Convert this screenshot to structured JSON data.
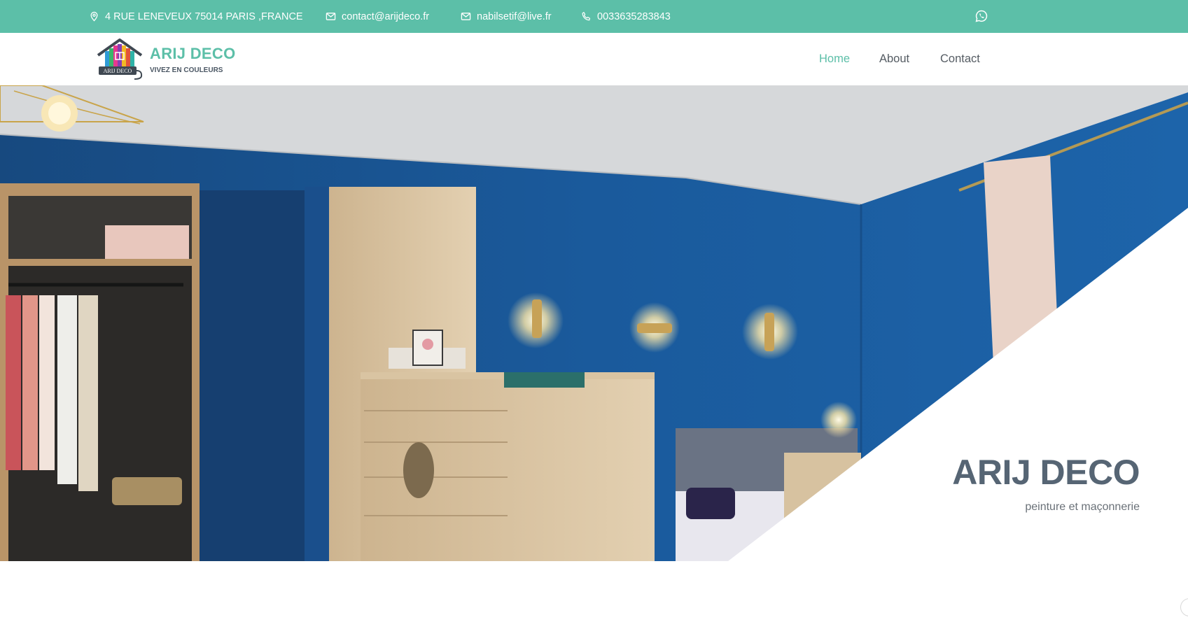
{
  "topbar": {
    "address": "4 RUE LENEVEUX 75014 PARIS ,FRANCE",
    "email_primary": "contact@arijdeco.fr",
    "email_secondary": "nabilsetif@live.fr",
    "phone": "0033635283843",
    "icons": [
      "location-pin-icon",
      "mail-icon",
      "mail-icon",
      "phone-icon",
      "whatsapp-icon"
    ],
    "background": "#5cbfa8"
  },
  "header": {
    "logo_label": "ARIJ DECO",
    "brand_title": "ARIJ DECO",
    "brand_tagline": "VIVEZ EN COULEURS",
    "nav": [
      {
        "label": "Home",
        "active": true
      },
      {
        "label": "About",
        "active": false
      },
      {
        "label": "Contact",
        "active": false
      }
    ]
  },
  "hero": {
    "title": "ARIJ DECO",
    "subtitle": "peinture et maçonnerie",
    "image_description_icon": "bedroom-photo"
  },
  "colors": {
    "accent": "#5cbfa8",
    "heading": "#566574",
    "wall_blue": "#1a5a9c"
  }
}
